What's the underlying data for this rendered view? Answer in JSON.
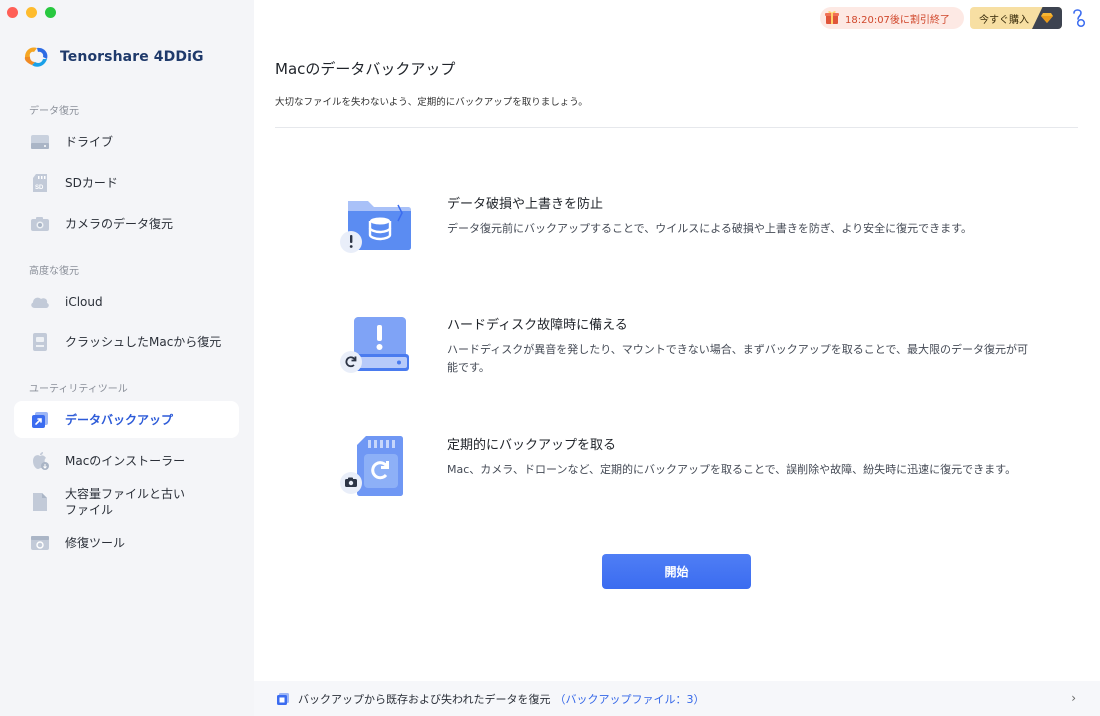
{
  "app": {
    "brand_name": "Tenorshare 4DDiG"
  },
  "sidebar": {
    "sections": [
      {
        "label": "データ復元"
      },
      {
        "label": "高度な復元"
      },
      {
        "label": "ユーティリティツール"
      }
    ],
    "items": [
      {
        "label": "ドライブ",
        "icon": "drive-icon"
      },
      {
        "label": "SDカード",
        "icon": "sd-card-icon"
      },
      {
        "label": "カメラのデータ復元",
        "icon": "camera-icon"
      },
      {
        "label": "iCloud",
        "icon": "cloud-icon"
      },
      {
        "label": "クラッシュしたMacから復元",
        "icon": "crashed-mac-icon"
      },
      {
        "label": "データバックアップ",
        "icon": "backup-icon",
        "active": true
      },
      {
        "label": "Macのインストーラー",
        "icon": "apple-installer-icon"
      },
      {
        "label": "大容量ファイルと古いファイル",
        "icon": "file-icon"
      },
      {
        "label": "修復ツール",
        "icon": "repair-icon"
      }
    ]
  },
  "topbar": {
    "timer_text": "18:20:07後に割引終了",
    "buy_label": "今すぐ購入"
  },
  "main": {
    "title": "Macのデータバックアップ",
    "subtitle": "大切なファイルを失わないよう、定期的にバックアップを取りましょう。",
    "features": [
      {
        "title": "データ破損や上書きを防止",
        "desc": "データ復元前にバックアップすることで、ウイルスによる破損や上書きを防ぎ、より安全に復元できます。"
      },
      {
        "title": "ハードディスク故障時に備える",
        "desc": "ハードディスクが異音を発したり、マウントできない場合、まずバックアップを取ることで、最大限のデータ復元が可能です。"
      },
      {
        "title": "定期的にバックアップを取る",
        "desc": "Mac、カメラ、ドローンなど、定期的にバックアップを取ることで、誤削除や故障、紛失時に迅速に復元できます。"
      }
    ],
    "start_label": "開始"
  },
  "footer": {
    "text": "バックアップから既存および失われたデータを復元",
    "link": "（バックアップファイル：3）"
  },
  "colors": {
    "accent": "#3b6cf0",
    "sidebar_bg": "#f4f5f8",
    "timer_text": "#d0472b",
    "buy_bg": "#f7dfa3"
  }
}
